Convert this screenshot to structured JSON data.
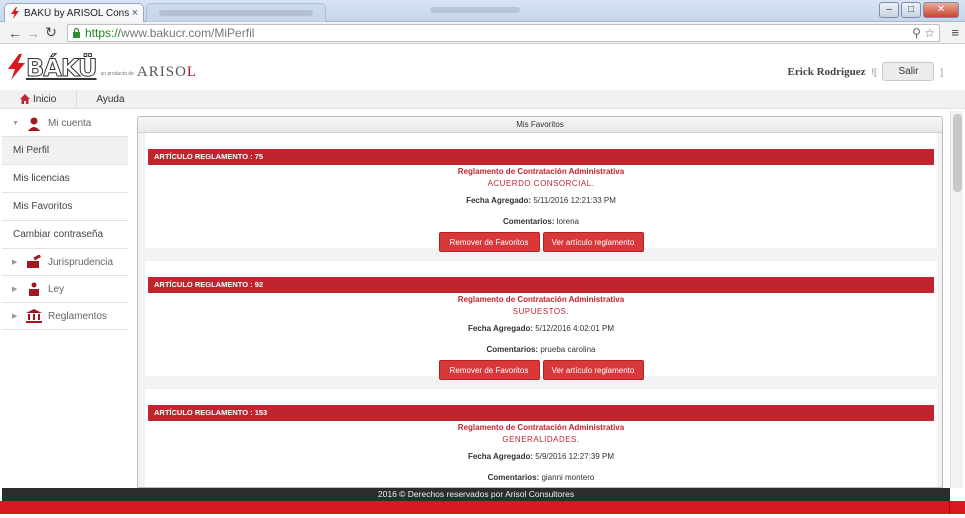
{
  "browser": {
    "tab_title": "BÁKÜ by ARISOL Consulto",
    "tab_close": "×",
    "url_https": "https://",
    "url_rest": "www.bakucr.com/MiPerfil",
    "win_min": "–",
    "win_max": "□",
    "win_close": "✕"
  },
  "header": {
    "logo_text": "BÁKÜ",
    "logo_byline": "un producto de",
    "logo_arisol_main": "ARISO",
    "logo_arisol_accent": "L",
    "user_name": "Erick Rodriguez",
    "user_bracket_open": "![",
    "logout_label": "Salir",
    "user_bracket_close": "]"
  },
  "topnav": {
    "home_label": "Inicio",
    "help_label": "Ayuda"
  },
  "sidebar": {
    "account_label": "Mi cuenta",
    "items": [
      {
        "label": "Mi Perfil"
      },
      {
        "label": "Mis licencias"
      },
      {
        "label": "Mis Favoritos"
      },
      {
        "label": "Cambiar contraseña"
      }
    ],
    "sections": [
      {
        "label": "Jurisprudencia"
      },
      {
        "label": "Ley"
      },
      {
        "label": "Reglamentos"
      }
    ]
  },
  "main": {
    "panel_title": "Mis Favoritos",
    "labels": {
      "fecha": "Fecha Agregado:",
      "comentarios": "Comentarios:",
      "remove_button": "Remover de Favoritos",
      "view_button": "Ver artículo reglamento"
    },
    "favorites": [
      {
        "header": "ARTÍCULO REGLAMENTO : 75",
        "title": "Reglamento de Contratación Administrativa",
        "subtitle": "ACUERDO CONSORCIAL.",
        "fecha": "5/11/2016 12:21:33 PM",
        "comentarios": "lorena"
      },
      {
        "header": "ARTÍCULO REGLAMENTO : 92",
        "title": "Reglamento de Contratación Administrativa",
        "subtitle": "SUPUESTOS.",
        "fecha": "5/12/2016 4:02:01 PM",
        "comentarios": "prueba carolina"
      },
      {
        "header": "ARTÍCULO REGLAMENTO : 153",
        "title": "Reglamento de Contratación Administrativa",
        "subtitle": "GENERALIDADES.",
        "fecha": "5/9/2016 12:27:39 PM",
        "comentarios": "gianni montero"
      }
    ]
  },
  "footer": {
    "text": "2016 © Derechos reservados por Arisol Consultores"
  },
  "colors": {
    "brand_red": "#c0242e",
    "button_red": "#d8383a",
    "footer_dark": "#2d2d2d"
  }
}
